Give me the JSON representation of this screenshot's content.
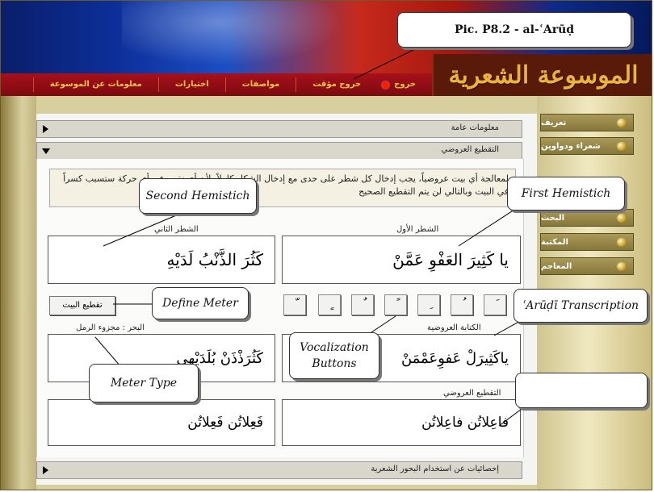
{
  "window_title": "Pic. P8.2 - al-ʿArūḍ",
  "logo_text": "الموسوعة الشعرية",
  "menu": [
    {
      "label": "معلومات عن الموسوعة"
    },
    {
      "label": "اختيارات"
    },
    {
      "label": "مواصفات"
    },
    {
      "label": "خروج مؤقت"
    },
    {
      "label": "خروج"
    }
  ],
  "sections": {
    "general_info": "معلومات عامة",
    "prosodic_scansion": "التقطيع العروضي",
    "statistics": "إحصائيات عن استخدام البحور الشعرية"
  },
  "notice": "لمعالجة أي بيت عروضياً، يجب إدخال كل شطر على حدى مع إدخال الشكل كاملاً، لأن أي نقص في أي حركة ستسبب كسراً في البيت وبالتالي لن يتم التقطيع الصحيح",
  "first_hemistich_label": "الشطر الأول",
  "second_hemistich_label": "الشطر الثاني",
  "first_hemistich_text": "يا كَثِيرَ العَفْوِ عَمَّنْ",
  "second_hemistich_text": "كَثُرَ الذَّنْبُ لَدَيْهِ",
  "vowel_buttons": [
    "َ",
    "ُ",
    "ِ",
    "ً",
    "ٌ",
    "ٍ",
    "ّ",
    "ْ"
  ],
  "define_meter_button": "تقطيع البيت",
  "meter_type": "البحر : مجزوء الرمل",
  "arudi_label": "الكتابة العروضية",
  "arudi_first": "ياكَثِيرَلْ عَفوِعَمْمَنْ",
  "arudi_second": "كَثُرَذْذَنْ بُلَدَيْهِي",
  "scansion_label": "التقطيع العروضي",
  "scansion_first": "فاعِلاتُن فاعِلاتُن",
  "scansion_second": "فَعِلاتُن فَعِلاتُن",
  "sidebar": [
    {
      "label": "تعريف"
    },
    {
      "label": "شعراء ودواوين"
    },
    {
      "label": "البحث"
    },
    {
      "label": "المكتبة"
    },
    {
      "label": "المعاجم"
    }
  ],
  "callouts": {
    "second_hemistich": "Second Hemistich",
    "first_hemistich": "First Hemistich",
    "define_meter": "Define Meter",
    "arudi_transcription": "ʿArūḍī Transcription",
    "vocalization_line1": "Vocalization",
    "vocalization_line2": "Buttons",
    "meter_type": "Meter Type"
  }
}
